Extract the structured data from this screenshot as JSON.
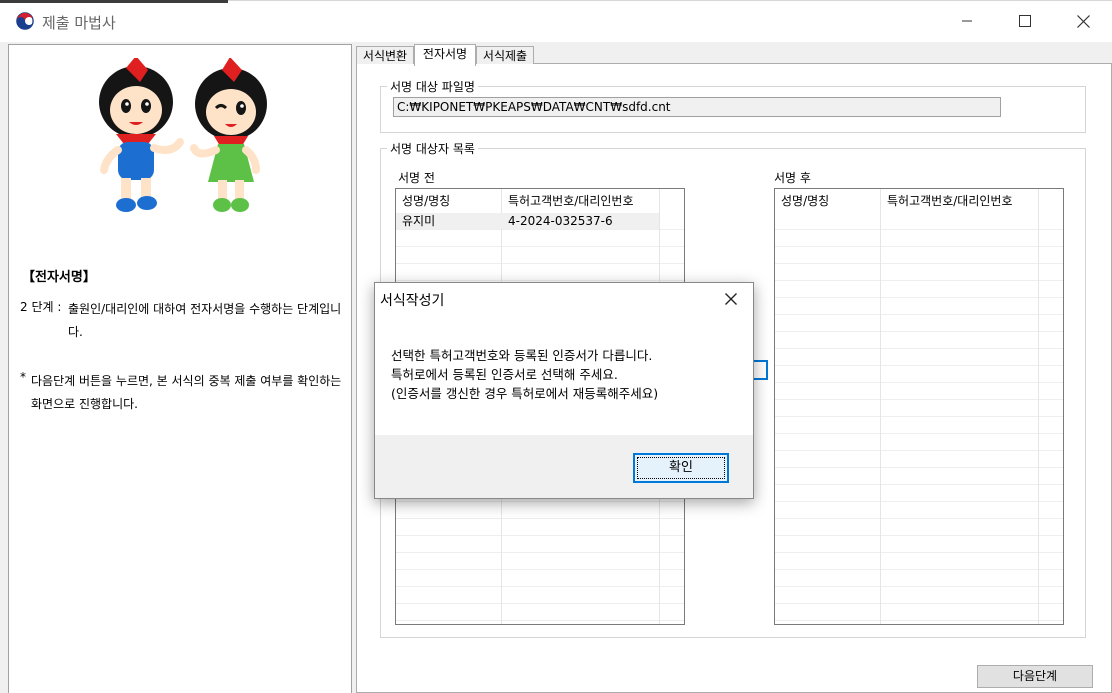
{
  "window": {
    "title": "제출 마법사",
    "controls": {
      "minimize": "minimize-icon",
      "maximize": "maximize-icon",
      "close": "close-icon"
    }
  },
  "left_panel": {
    "section_title": "【전자서명】",
    "step_label": "2 단계 :",
    "step_text": "출원인/대리인에 대하여 전자서명을 수행하는 단계입니다.",
    "note_star": "*",
    "note_text": "다음단계 버튼을 누르면, 본 서식의 중복 제출 여부를 확인하는 화면으로 진행합니다."
  },
  "tabs": [
    {
      "label": "서식변환",
      "active": false
    },
    {
      "label": "전자서명",
      "active": true
    },
    {
      "label": "서식제출",
      "active": false
    }
  ],
  "file_group": {
    "title": "서명 대상 파일명",
    "path": "C:₩KIPONET₩PKEAPS₩DATA₩CNT₩sdfd.cnt"
  },
  "signer_group": {
    "title": "서명 대상자 목록",
    "before": {
      "label": "서명 전",
      "columns": [
        "성명/명칭",
        "특허고객번호/대리인번호"
      ],
      "rows": [
        [
          "유지미",
          "4-2024-032537-6"
        ]
      ]
    },
    "after": {
      "label": "서명 후",
      "columns": [
        "성명/명칭",
        "특허고객번호/대리인번호"
      ],
      "rows": []
    }
  },
  "next_button": "다음단계",
  "dialog": {
    "title": "서식작성기",
    "message_lines": [
      "선택한 특허고객번호와 등록된 인증서가 다릅니다.",
      "특허로에서 등록된 인증서로 선택해 주세요.",
      "(인증서를 갱신한 경우 특허로에서 재등록해주세요)"
    ],
    "ok_label": "확인"
  },
  "colors": {
    "accent": "#0078d7",
    "mascot_red": "#e02020",
    "mascot_blue": "#1c6fd1",
    "mascot_green": "#5cc146"
  }
}
